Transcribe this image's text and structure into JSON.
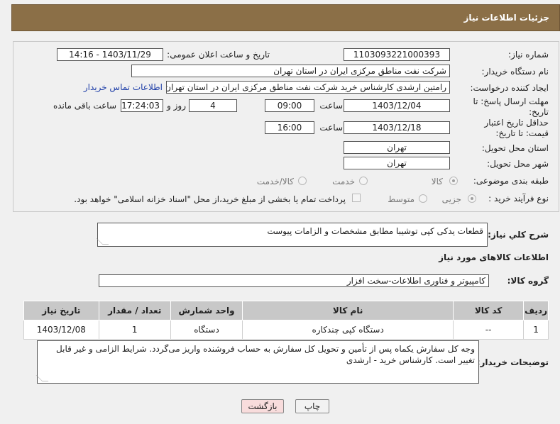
{
  "header": {
    "title": "جزئیات اطلاعات نیاز"
  },
  "form": {
    "need_number_label": "شماره نیاز:",
    "need_number": "1103093221000393",
    "announce_label": "تاریخ و ساعت اعلان عمومی:",
    "announce_value": "1403/11/29 - 14:16",
    "buyer_org_label": "نام دستگاه خریدار:",
    "buyer_org": "شرکت نفت مناطق مرکزی ایران در استان تهران",
    "requester_label": "ایجاد کننده درخواست:",
    "requester": "رامتین ارشدی کارشناس خرید شرکت نفت مناطق مرکزی ایران در استان تهران",
    "contact_link": "اطلاعات تماس خریدار",
    "reply_deadline_label": "مهلت ارسال پاسخ: تا تاریخ:",
    "reply_date": "1403/12/04",
    "time_label": "ساعت",
    "reply_time": "09:00",
    "days_value": "4",
    "days_label": "روز و",
    "remaining_time": "17:24:03",
    "remaining_label": "ساعت باقی مانده",
    "validity_label": "حداقل تاریخ اعتبار قیمت: تا تاریخ:",
    "validity_date": "1403/12/18",
    "validity_time_label": "ساعت",
    "validity_time": "16:00",
    "province_label": "استان محل تحویل:",
    "province": "تهران",
    "city_label": "شهر محل تحویل:",
    "city": "تهران",
    "category_label": "طبقه بندی موضوعی:",
    "category_options": [
      "کالا",
      "خدمت",
      "کالا/خدمت"
    ],
    "process_label": "نوع فرآیند خرید :",
    "process_options": [
      "جزیی",
      "متوسط"
    ],
    "payment_note": "پرداخت تمام یا بخشی از مبلغ خرید،از محل \"اسناد خزانه اسلامی\" خواهد بود."
  },
  "description": {
    "label": "شرح کلي نياز:",
    "text": "قطعات یدکی کپی توشیبا مطابق مشخصات و الزامات پیوست"
  },
  "goods_section": {
    "title": "اطلاعات کالاهای مورد نیاز"
  },
  "goods_group": {
    "label": "گروه کالا:",
    "value": "کامپیوتر و فناوری اطلاعات-سخت افزار"
  },
  "table": {
    "headers": [
      "ردیف",
      "کد کالا",
      "نام کالا",
      "واحد شمارش",
      "تعداد / مقدار",
      "تاریخ نیاز"
    ],
    "rows": [
      [
        "1",
        "--",
        "دستگاه کپی چندکاره",
        "دستگاه",
        "1",
        "1403/12/08"
      ]
    ]
  },
  "buyer_notes": {
    "label": "توضیحات خریدار:",
    "text": "وجه کل سفارش یکماه پس از تأمین و تحویل کل سفارش به حساب فروشنده واریز می‌گردد. شرایط الزامی و غیر قابل تغییر است. کارشناس خرید - ارشدی"
  },
  "buttons": {
    "print": "چاپ",
    "back": "بازگشت"
  },
  "colors": {
    "header": "#8b6f47",
    "back_button": "#f8dcdc",
    "table_header": "#c8c8c8"
  }
}
